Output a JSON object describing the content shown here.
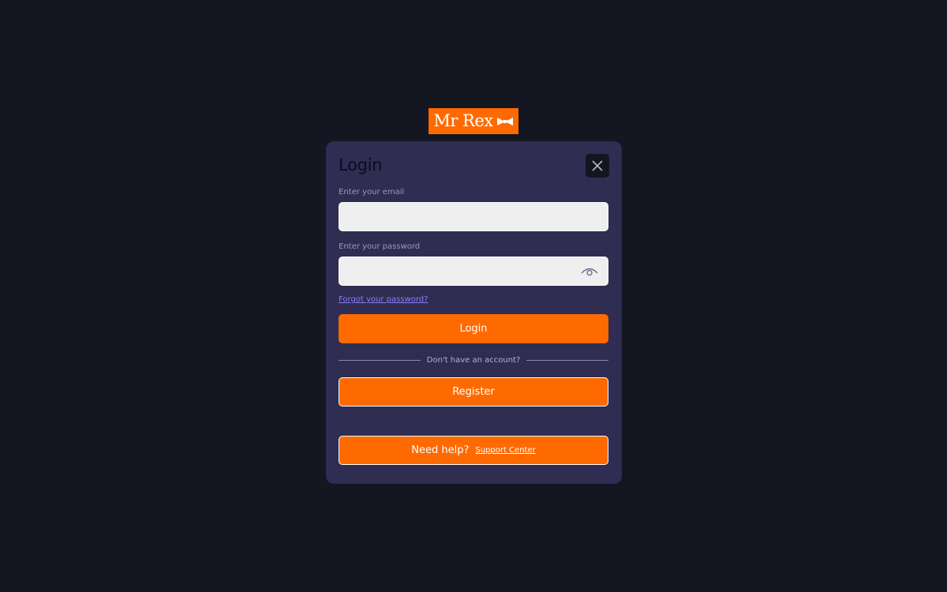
{
  "brand": {
    "logo_text": "Mr Rex",
    "logo_bg": "#ff6a00"
  },
  "login_modal": {
    "title": "Login",
    "close_icon": "close-icon",
    "email": {
      "label": "Enter your email",
      "value": "",
      "placeholder": ""
    },
    "password": {
      "label": "Enter your password",
      "value": "",
      "placeholder": "",
      "toggle_icon": "eye-icon"
    },
    "forgot_password_link": "Forgot your password?",
    "login_button": "Login",
    "divider_text": "Don't have an account?",
    "register_button": "Register",
    "help": {
      "text": "Need help?",
      "link": "Support Center"
    }
  },
  "colors": {
    "page_background": "#141622",
    "modal_background": "#2f2d52",
    "accent": "#ff6a00",
    "link": "#8b7cf6"
  }
}
